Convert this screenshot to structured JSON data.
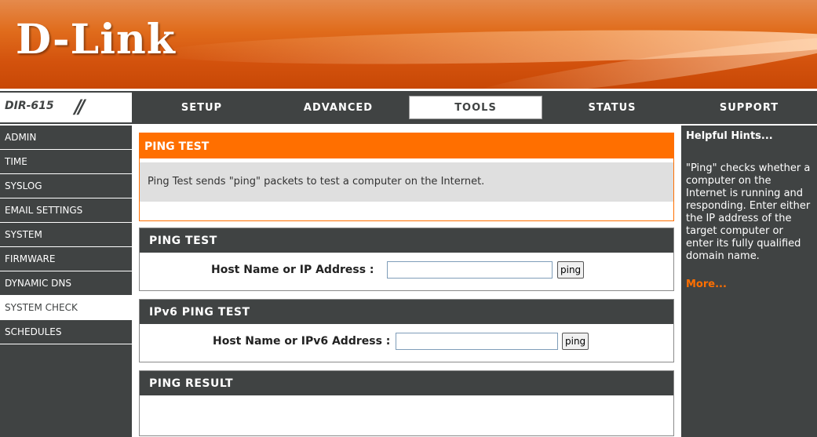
{
  "brand": {
    "logo": "D-Link",
    "model": "DIR-615",
    "slashes": "//"
  },
  "nav": {
    "tabs": [
      {
        "label": "SETUP"
      },
      {
        "label": "ADVANCED"
      },
      {
        "label": "TOOLS",
        "active": true
      },
      {
        "label": "STATUS"
      }
    ],
    "support": "SUPPORT"
  },
  "sidebar": {
    "items": [
      {
        "label": "ADMIN"
      },
      {
        "label": "TIME"
      },
      {
        "label": "SYSLOG"
      },
      {
        "label": "EMAIL SETTINGS"
      },
      {
        "label": "SYSTEM"
      },
      {
        "label": "FIRMWARE"
      },
      {
        "label": "DYNAMIC DNS"
      },
      {
        "label": "SYSTEM CHECK",
        "active": true
      },
      {
        "label": "SCHEDULES"
      }
    ]
  },
  "main": {
    "intro": {
      "title": "PING TEST",
      "description": "Ping Test sends \"ping\" packets to test a computer on the Internet."
    },
    "ping": {
      "title": "PING TEST",
      "label": "Host Name or IP Address  :",
      "value": "",
      "button": "ping"
    },
    "ping6": {
      "title": "IPv6 PING TEST",
      "label": "Host Name or IPv6 Address :",
      "value": "",
      "button": "ping"
    },
    "result": {
      "title": "PING RESULT"
    }
  },
  "hints": {
    "title": "Helpful Hints...",
    "text": "\"Ping\" checks whether a computer on the Internet is running and responding. Enter either the IP address of the target computer or enter its fully qualified domain name.",
    "more": "More..."
  },
  "colors": {
    "accent": "#ff6f00",
    "dark": "#404343"
  }
}
